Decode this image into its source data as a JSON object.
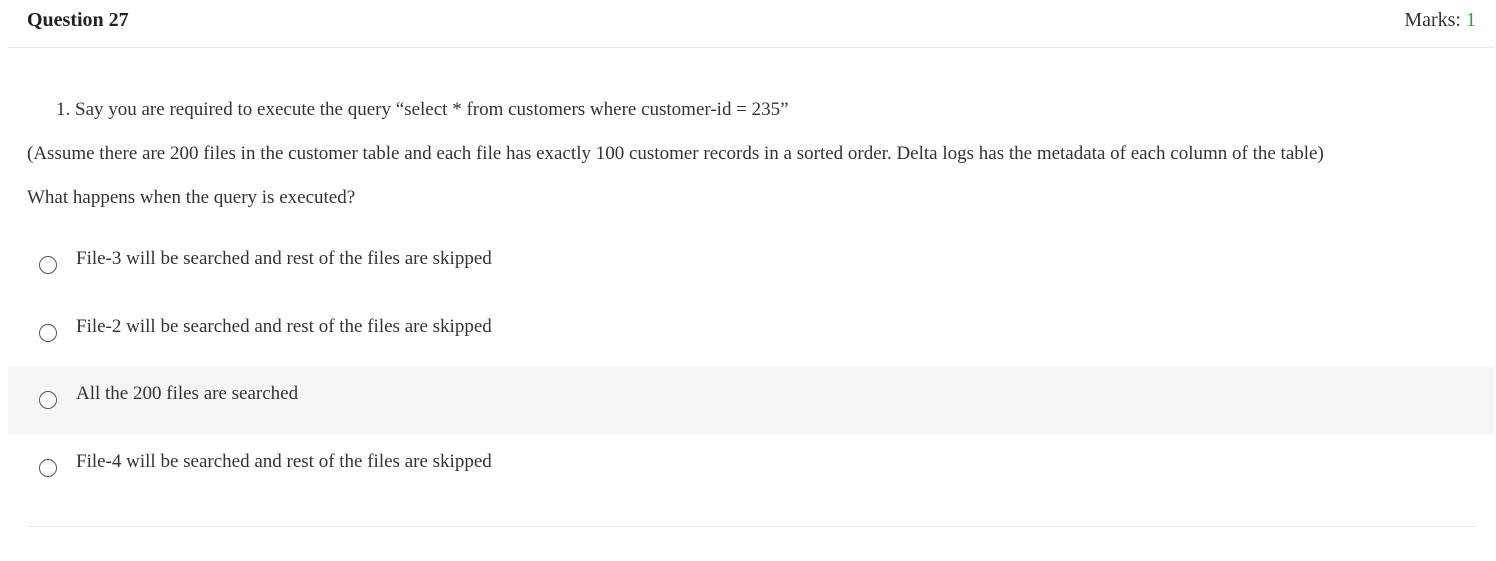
{
  "question": {
    "title": "Question 27",
    "marks_label": "Marks:",
    "marks_value": "1",
    "number": "1.",
    "prompt": "Say you are required to execute the query “select * from customers where customer-id = 235”",
    "assumption": "(Assume there are 200 files in the customer table and each file has exactly 100 customer records in a sorted order. Delta logs has the metadata of each column of the table)",
    "ask": "What happens when the query is executed?"
  },
  "options": [
    {
      "label": "File-3 will be searched and rest of the files are skipped"
    },
    {
      "label": "File-2 will be searched and rest of the files are skipped"
    },
    {
      "label": "All the 200 files are searched"
    },
    {
      "label": "File-4 will be searched and rest of the files are skipped"
    }
  ],
  "colors": {
    "marks_value": "#3a9a3a",
    "hover_row": "#f6f6f6",
    "divider": "#e8e8e8"
  }
}
